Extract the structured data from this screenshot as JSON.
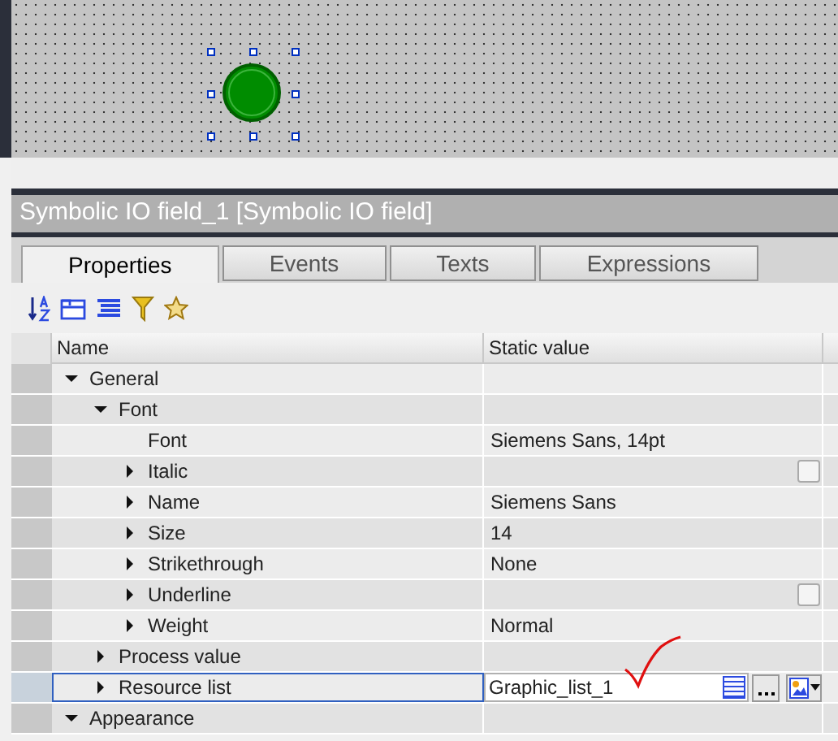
{
  "inspector": {
    "title": "Symbolic IO field_1 [Symbolic IO field]"
  },
  "tabs": [
    {
      "label": "Properties",
      "selected": true
    },
    {
      "label": "Events",
      "selected": false
    },
    {
      "label": "Texts",
      "selected": false
    },
    {
      "label": "Expressions",
      "selected": false
    }
  ],
  "table": {
    "columns": [
      "Name",
      "Static value"
    ],
    "rows": [
      {
        "name": "General",
        "expanded": true,
        "selected": false,
        "children": [
          {
            "name": "Font",
            "expanded": true,
            "selected": false,
            "children": [
              {
                "name": "Font",
                "selected": false,
                "value": "Siemens Sans, 14pt"
              },
              {
                "name": "Italic",
                "expanded": false,
                "selected": false,
                "kind": "checkbox",
                "checked": false
              },
              {
                "name": "Name",
                "expanded": false,
                "selected": false,
                "value": "Siemens Sans"
              },
              {
                "name": "Size",
                "expanded": false,
                "selected": false,
                "value": "14"
              },
              {
                "name": "Strikethrough",
                "expanded": false,
                "selected": false,
                "value": "None"
              },
              {
                "name": "Underline",
                "expanded": false,
                "selected": false,
                "kind": "checkbox",
                "checked": false
              },
              {
                "name": "Weight",
                "expanded": false,
                "selected": false,
                "value": "Normal"
              }
            ]
          },
          {
            "name": "Process value",
            "expanded": false,
            "selected": false
          },
          {
            "name": "Resource list",
            "expanded": false,
            "selected": true,
            "kind": "editor",
            "value": "Graphic_list_1"
          }
        ]
      },
      {
        "name": "Appearance",
        "expanded": true,
        "selected": false
      }
    ]
  }
}
